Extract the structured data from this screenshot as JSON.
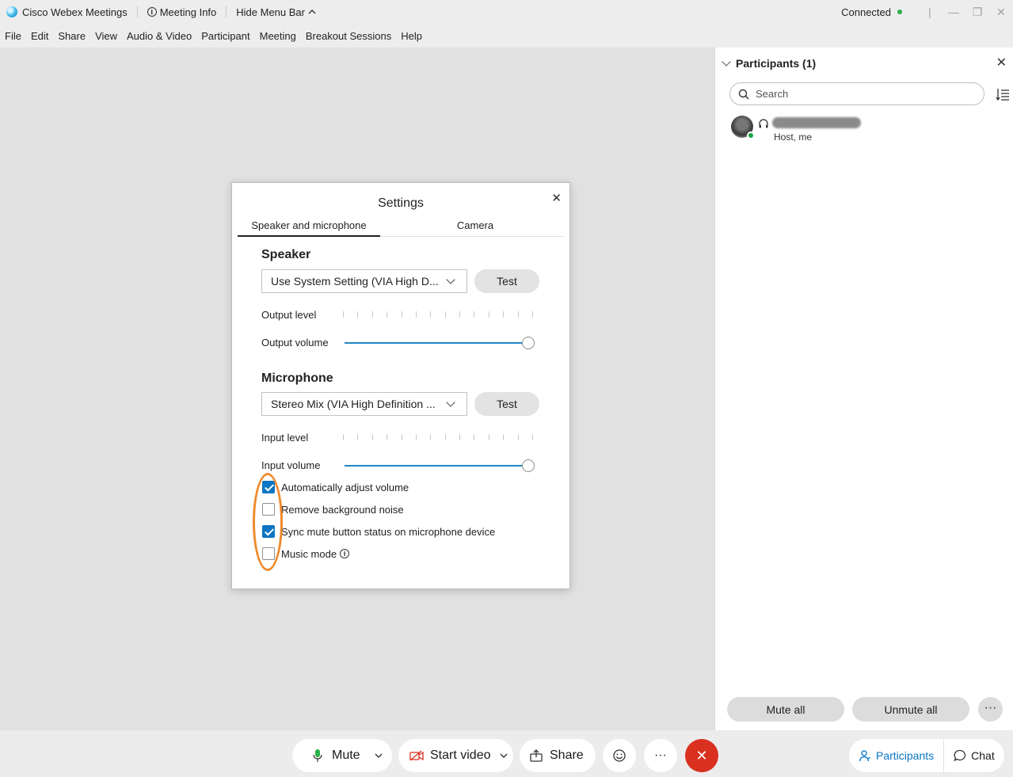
{
  "titlebar": {
    "app_title": "Cisco Webex Meetings",
    "meeting_info": "Meeting Info",
    "hide_menu_bar": "Hide Menu Bar",
    "status": "Connected",
    "status_color": "#2cb04b"
  },
  "menu": {
    "items": [
      "File",
      "Edit",
      "Share",
      "View",
      "Audio & Video",
      "Participant",
      "Meeting",
      "Breakout Sessions",
      "Help"
    ]
  },
  "participants_panel": {
    "title": "Participants (1)",
    "search_placeholder": "Search",
    "participant_role": "Host, me",
    "mute_all": "Mute all",
    "unmute_all": "Unmute all"
  },
  "settings": {
    "title": "Settings",
    "tabs": [
      "Speaker and microphone",
      "Camera"
    ],
    "active_tab": "Speaker and microphone",
    "speaker": {
      "heading": "Speaker",
      "device": "Use System Setting (VIA High D...",
      "test_label": "Test",
      "output_level_label": "Output level",
      "output_volume_label": "Output volume",
      "output_volume_value": 1.0
    },
    "microphone": {
      "heading": "Microphone",
      "device": "Stereo Mix (VIA High Definition ...",
      "test_label": "Test",
      "input_level_label": "Input level",
      "input_volume_label": "Input volume",
      "input_volume_value": 1.0
    },
    "options": [
      {
        "label": "Automatically adjust volume",
        "checked": true
      },
      {
        "label": "Remove background noise",
        "checked": false
      },
      {
        "label": "Sync mute button status on microphone device",
        "checked": true
      },
      {
        "label": "Music mode",
        "checked": false
      }
    ]
  },
  "bottom_bar": {
    "mute": "Mute",
    "start_video": "Start video",
    "share": "Share",
    "participants_tab": "Participants",
    "chat_tab": "Chat",
    "end_color": "#d9301f",
    "accent_color": "#0a75c2"
  },
  "annotation": {
    "highlight_color": "#f08a2c"
  }
}
